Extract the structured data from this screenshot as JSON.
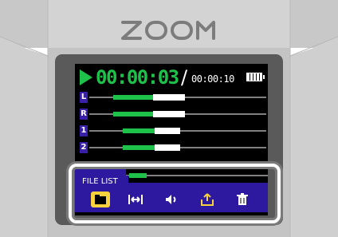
{
  "device": {
    "brand": "ZOOM"
  },
  "timecode": {
    "elapsed": "00:00:03",
    "total": "00:00:10",
    "separator": "/"
  },
  "tracks": [
    {
      "label": "L"
    },
    {
      "label": "R"
    },
    {
      "label": "1"
    },
    {
      "label": "2"
    }
  ],
  "file_list": {
    "label": "FILE LIST"
  },
  "toolbar": {
    "items": [
      {
        "name": "folder-icon",
        "selected": true
      },
      {
        "name": "trim-icon",
        "selected": false
      },
      {
        "name": "speaker-icon",
        "selected": false
      },
      {
        "name": "export-icon",
        "selected": false
      },
      {
        "name": "trash-icon",
        "selected": false
      }
    ]
  },
  "colors": {
    "accent_green": "#1ec24a",
    "panel_blue": "#2d18a0",
    "selected_yellow": "#f7d23b"
  }
}
